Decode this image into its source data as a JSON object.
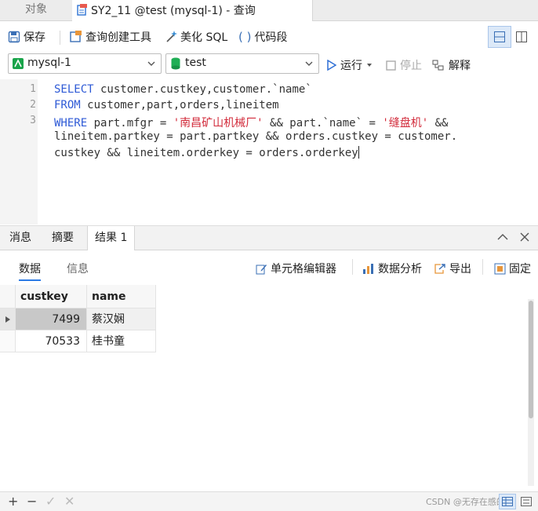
{
  "tabs": {
    "objects": "对象",
    "query": "SY2_11 @test (mysql-1) - 查询"
  },
  "toolbar": {
    "save": "保存",
    "query_builder": "查询创建工具",
    "beautify": "美化 SQL",
    "snippet": "代码段"
  },
  "selectors": {
    "connection": "mysql-1",
    "database": "test",
    "run": "运行",
    "stop": "停止",
    "explain": "解释"
  },
  "editor": {
    "line_numbers": [
      "1",
      "2",
      "3"
    ],
    "lines": [
      [
        [
          "kw",
          "SELECT"
        ],
        [
          "t",
          " customer.custkey,customer.`name`"
        ]
      ],
      [
        [
          "kw",
          "FROM"
        ],
        [
          "t",
          " customer,part,orders,lineitem"
        ]
      ],
      [
        [
          "kw",
          "WHERE"
        ],
        [
          "t",
          " part.mfgr = "
        ],
        [
          "str",
          "'南昌矿山机械厂'"
        ],
        [
          "t",
          " && part.`name` = "
        ],
        [
          "str",
          "'缝盘机'"
        ],
        [
          "t",
          " &&"
        ]
      ],
      [
        [
          "t",
          "lineitem.partkey = part.partkey && orders.custkey = customer."
        ]
      ],
      [
        [
          "t",
          "custkey && lineitem.orderkey = orders.orderkey"
        ]
      ]
    ]
  },
  "result_tabs": {
    "messages": "消息",
    "summary": "摘要",
    "result1": "结果 1"
  },
  "result_toolbar": {
    "data": "数据",
    "info": "信息",
    "cell_editor": "单元格编辑器",
    "analysis": "数据分析",
    "export": "导出",
    "pin": "固定"
  },
  "table": {
    "columns": [
      "custkey",
      "name"
    ],
    "rows": [
      [
        "7499",
        "蔡汉娴"
      ],
      [
        "70533",
        "桂书童"
      ]
    ]
  },
  "watermark": "CSDN @无存在感的人"
}
